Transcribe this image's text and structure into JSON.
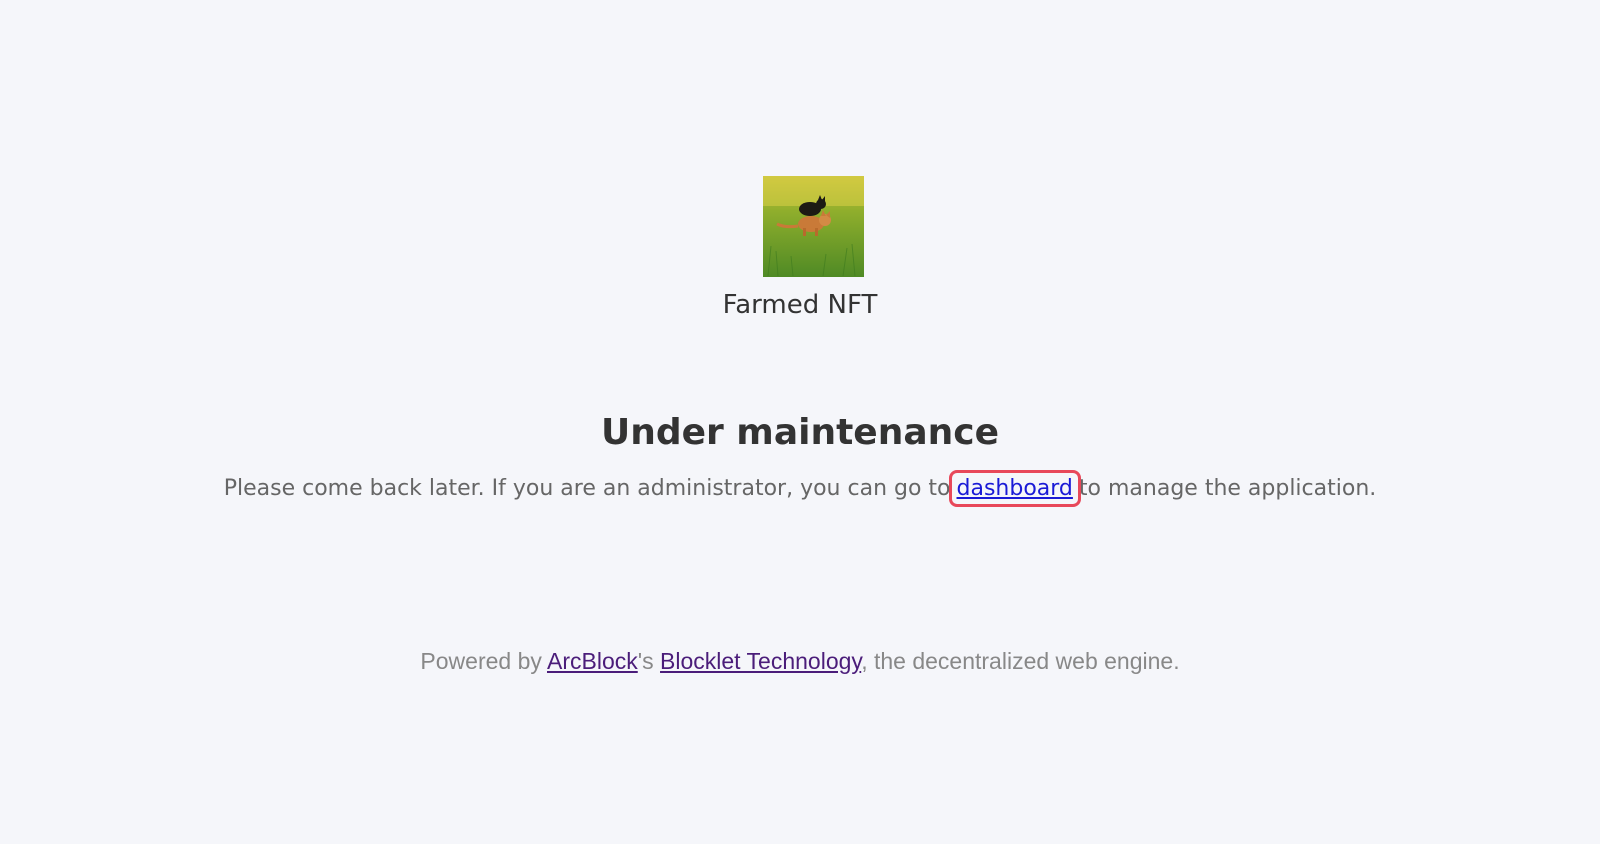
{
  "app": {
    "logo_icon": "cats-on-grass-image",
    "name": "Farmed NFT"
  },
  "maintenance": {
    "headline": "Under maintenance",
    "message_before": "Please come back later. If you are an administrator, you can go to",
    "dashboard_link": "dashboard",
    "message_after": "to manage the application."
  },
  "footer": {
    "prefix": "Powered by ",
    "arcblock_link": "ArcBlock",
    "possessive": "'s ",
    "blocklet_link": "Blocklet Technology",
    "suffix": ", the decentralized web engine."
  },
  "colors": {
    "background": "#f5f6fa",
    "link": "#1a1ad6",
    "visited_link": "#4b1d7a",
    "highlight_box": "#e8485a"
  }
}
